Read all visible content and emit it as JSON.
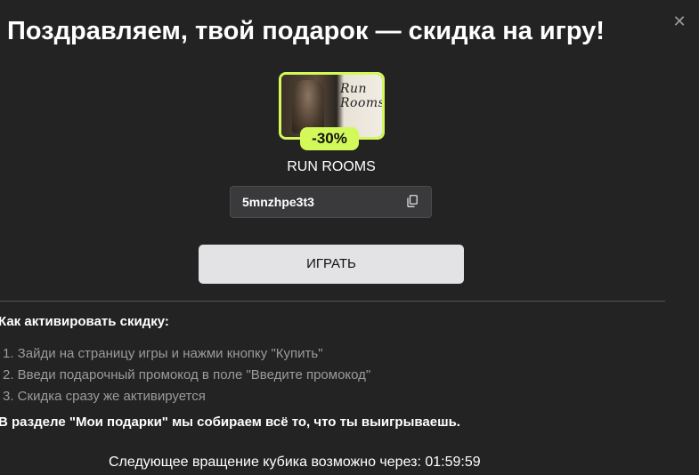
{
  "modal": {
    "title": "Поздравляем, твой подарок — скидка на игру!",
    "close_icon": "close-icon"
  },
  "game": {
    "cover_text_line1": "Run",
    "cover_text_line2": "Rooms",
    "discount": "-30%",
    "name": "RUN ROOMS"
  },
  "promo": {
    "code": "5mnzhpe3t3",
    "copy_icon": "copy-icon"
  },
  "play_button": {
    "label": "ИГРАТЬ"
  },
  "howto": {
    "title": "Как активировать скидку:",
    "steps": [
      "1. Зайди на страницу игры и нажми кнопку \"Купить\"",
      "2. Введи подарочный промокод в поле \"Введите промокод\"",
      "3. Скидка сразу же активируется"
    ],
    "gifts_note": "В разделе \"Мои подарки\" мы собираем всё то, что ты выигрываешь."
  },
  "timer": {
    "label": "Следующее вращение кубика возможно через:",
    "value": "01:59:59"
  },
  "colors": {
    "background": "#232323",
    "accent": "#d3f85a",
    "button": "#e3e3e6",
    "muted_text": "#9b9b9b"
  }
}
